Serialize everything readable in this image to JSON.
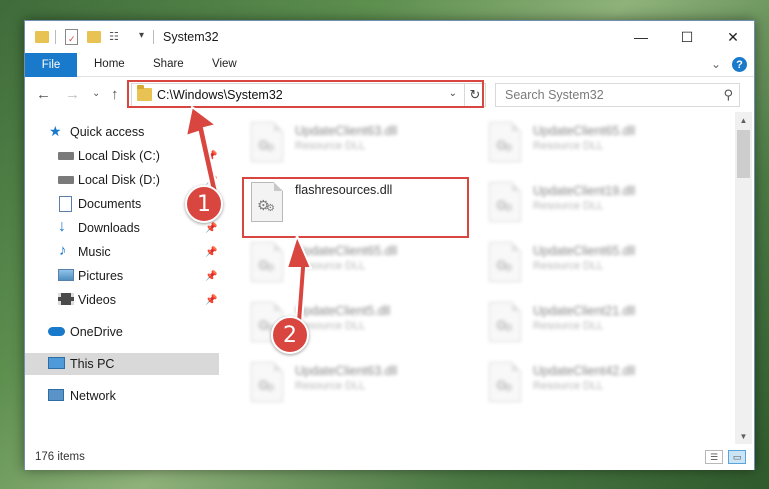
{
  "window": {
    "title": "System32",
    "controls": {
      "minimize": "—",
      "maximize": "☐",
      "close": "✕"
    }
  },
  "ribbon": {
    "tabs": [
      "File",
      "Home",
      "Share",
      "View"
    ],
    "help": "?"
  },
  "navigation": {
    "address": "C:\\Windows\\System32",
    "search_placeholder": "Search System32"
  },
  "sidebar": {
    "items": [
      {
        "label": "Quick access",
        "icon": "star-icon"
      },
      {
        "label": "Local Disk (C:)",
        "icon": "drive-icon",
        "pinned": true
      },
      {
        "label": "Local Disk (D:)",
        "icon": "drive-icon",
        "pinned": true
      },
      {
        "label": "Documents",
        "icon": "documents-icon",
        "pinned": true
      },
      {
        "label": "Downloads",
        "icon": "download-icon",
        "pinned": true
      },
      {
        "label": "Music",
        "icon": "music-icon",
        "pinned": true
      },
      {
        "label": "Pictures",
        "icon": "pictures-icon",
        "pinned": true
      },
      {
        "label": "Videos",
        "icon": "videos-icon",
        "pinned": true
      },
      {
        "label": "OneDrive",
        "icon": "cloud-icon"
      },
      {
        "label": "This PC",
        "icon": "computer-icon",
        "selected": true
      },
      {
        "label": "Network",
        "icon": "network-icon"
      }
    ]
  },
  "files": [
    {
      "name": "UpdateClient63.dll",
      "type": "Resource DLL"
    },
    {
      "name": "UpdateClient65.dll",
      "type": "Resource DLL"
    },
    {
      "name": "flashresources.dll",
      "type": "",
      "highlighted": true
    },
    {
      "name": "UpdateClient19.dll",
      "type": "Resource DLL"
    },
    {
      "name": "UpdateClient65.dll",
      "type": "Resource DLL"
    },
    {
      "name": "UpdateClient65.dll",
      "type": "Resource DLL"
    },
    {
      "name": "UpdateClient5.dll",
      "type": "Resource DLL"
    },
    {
      "name": "UpdateClient21.dll",
      "type": "Resource DLL"
    },
    {
      "name": "UpdateClient63.dll",
      "type": "Resource DLL"
    },
    {
      "name": "UpdateClient42.dll",
      "type": "Resource DLL"
    }
  ],
  "status": {
    "item_count": "176 items"
  },
  "annotations": {
    "step1": "1",
    "step2": "2",
    "color": "#d9453f"
  }
}
